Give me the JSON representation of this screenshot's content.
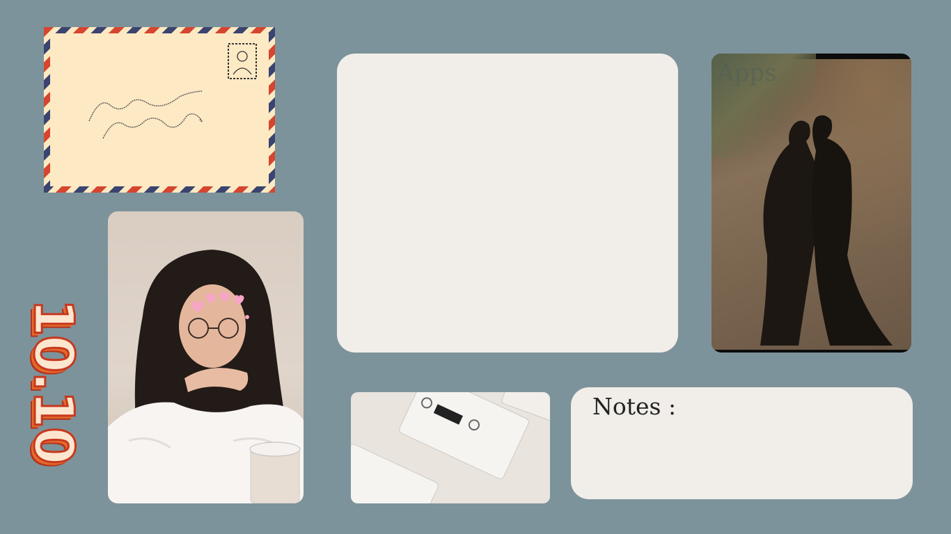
{
  "date_text": "10.10",
  "notes": {
    "title": "Notes :"
  },
  "shadow_photo": {
    "watermark": "Apps"
  },
  "colors": {
    "background": "#7d939b",
    "card": "#f1eeea",
    "envelope": "#fde9c4",
    "envelope_red": "#d6452f",
    "envelope_blue": "#3b4470",
    "date_fill": "#fde6cf",
    "date_outline": "#c7381e"
  },
  "icons": [
    "envelope-icon",
    "stamp-icon",
    "hearts-icon"
  ]
}
